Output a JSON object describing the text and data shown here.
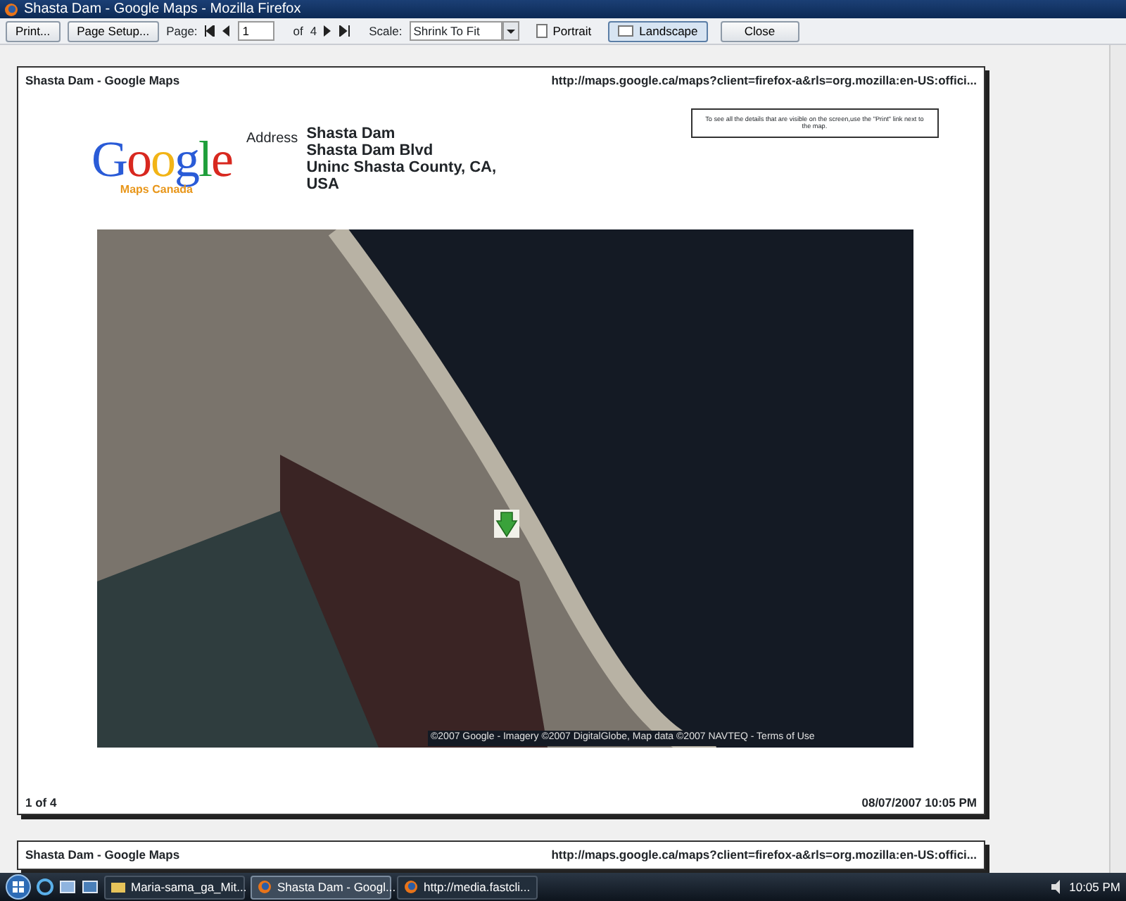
{
  "window": {
    "title": "Shasta Dam - Google Maps - Mozilla Firefox"
  },
  "toolbar": {
    "print": "Print...",
    "page_setup": "Page Setup...",
    "page_label": "Page:",
    "page_value": "1",
    "of_label": "of",
    "page_count": "4",
    "scale_label": "Scale:",
    "scale_value": "Shrink To Fit",
    "orientations": [
      {
        "label": "Portrait",
        "selected": false
      },
      {
        "label": "Landscape",
        "selected": true
      }
    ],
    "close": "Close"
  },
  "pages": [
    {
      "header_left": "Shasta Dam - Google Maps",
      "header_right": "http://maps.google.ca/maps?client=firefox-a&rls=org.mozilla:en-US:offici...",
      "logo_text": "Google",
      "logo_sub": "Maps Canada",
      "address_label": "Address",
      "address_lines": [
        "Shasta Dam",
        "Shasta Dam Blvd",
        "Uninc Shasta County, CA, USA"
      ],
      "hint": "To see all the details that are visible on the screen,use the \"Print\" link next to the map.",
      "map_attribution": "©2007 Google - Imagery ©2007 DigitalGlobe, Map data ©2007 NAVTEQ - Terms of Use",
      "footer_left": "1 of 4",
      "footer_right": "08/07/2007 10:05 PM"
    },
    {
      "header_left": "Shasta Dam - Google Maps",
      "header_right": "http://maps.google.ca/maps?client=firefox-a&rls=org.mozilla:en-US:offici..."
    }
  ],
  "taskbar": {
    "items": [
      {
        "label": "Maria-sama_ga_Mit...",
        "kind": "folder",
        "selected": false
      },
      {
        "label": "Shasta Dam - Googl...",
        "kind": "firefox",
        "selected": true
      },
      {
        "label": "http://media.fastcli...",
        "kind": "firefox",
        "selected": false
      }
    ],
    "clock": "10:05 PM"
  }
}
